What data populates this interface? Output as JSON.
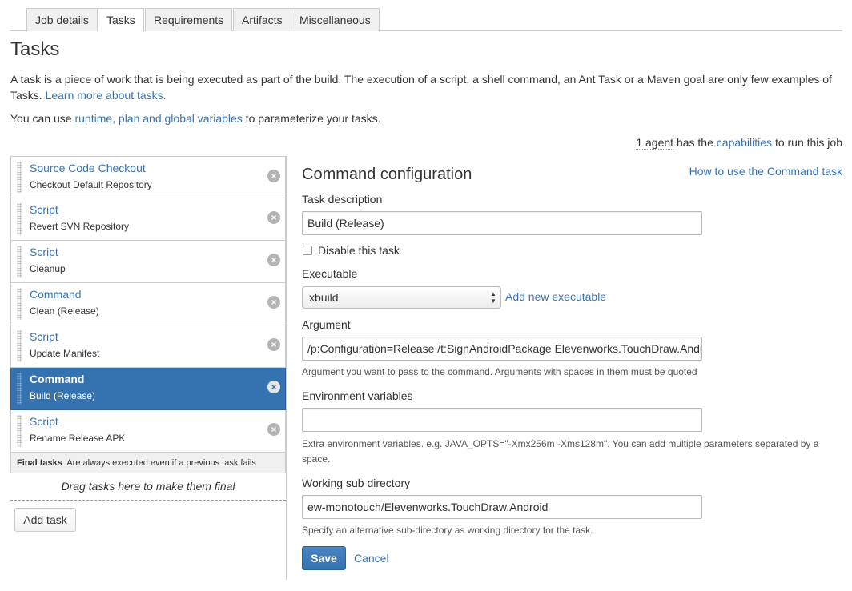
{
  "tabs": [
    {
      "label": "Job details",
      "active": false
    },
    {
      "label": "Tasks",
      "active": true
    },
    {
      "label": "Requirements",
      "active": false
    },
    {
      "label": "Artifacts",
      "active": false
    },
    {
      "label": "Miscellaneous",
      "active": false
    }
  ],
  "page": {
    "title": "Tasks",
    "intro_text": "A task is a piece of work that is being executed as part of the build. The execution of a script, a shell command, an Ant Task or a Maven goal are only few examples of Tasks.",
    "learn_more_link": "Learn more about tasks.",
    "vars_prefix": "You can use",
    "vars_link": "runtime, plan and global variables",
    "vars_suffix": "to parameterize your tasks.",
    "agents_count": "1 agent",
    "agents_mid": "has the",
    "agents_link": "capabilities",
    "agents_suffix": "to run this job"
  },
  "tasks": [
    {
      "name": "Source Code Checkout",
      "description": "Checkout Default Repository",
      "selected": false
    },
    {
      "name": "Script",
      "description": "Revert SVN Repository",
      "selected": false
    },
    {
      "name": "Script",
      "description": "Cleanup",
      "selected": false
    },
    {
      "name": "Command",
      "description": "Clean (Release)",
      "selected": false
    },
    {
      "name": "Script",
      "description": "Update Manifest",
      "selected": false
    },
    {
      "name": "Command",
      "description": "Build (Release)",
      "selected": true
    },
    {
      "name": "Script",
      "description": "Rename Release APK",
      "selected": false
    }
  ],
  "final_tasks": {
    "title": "Final tasks",
    "note": "Are always executed even if a previous task fails",
    "drop_hint": "Drag tasks here to make them final"
  },
  "add_task_label": "Add task",
  "config": {
    "title": "Command configuration",
    "help_link": "How to use the Command task",
    "task_description_label": "Task description",
    "task_description_value": "Build (Release)",
    "disable_label": "Disable this task",
    "disable_checked": false,
    "executable_label": "Executable",
    "executable_value": "xbuild",
    "add_executable_link": "Add new executable",
    "argument_label": "Argument",
    "argument_value": "/p:Configuration=Release /t:SignAndroidPackage Elevenworks.TouchDraw.Android",
    "argument_hint": "Argument you want to pass to the command. Arguments with spaces in them must be quoted",
    "env_label": "Environment variables",
    "env_value": "",
    "env_hint": "Extra environment variables. e.g. JAVA_OPTS=\"-Xmx256m -Xms128m\". You can add multiple parameters separated by a space.",
    "workdir_label": "Working sub directory",
    "workdir_value": "ew-monotouch/Elevenworks.TouchDraw.Android",
    "workdir_hint": "Specify an alternative sub-directory as working directory for the task.",
    "save_label": "Save",
    "cancel_label": "Cancel"
  },
  "colors": {
    "link": "#3b73af",
    "selected_bg": "#3572b0",
    "primary_button": "#3572b0"
  },
  "icons": {
    "task_delete": "close-circle-icon",
    "task_drag": "drag-handle-icon",
    "select_arrows": "up-down-arrows-icon"
  }
}
